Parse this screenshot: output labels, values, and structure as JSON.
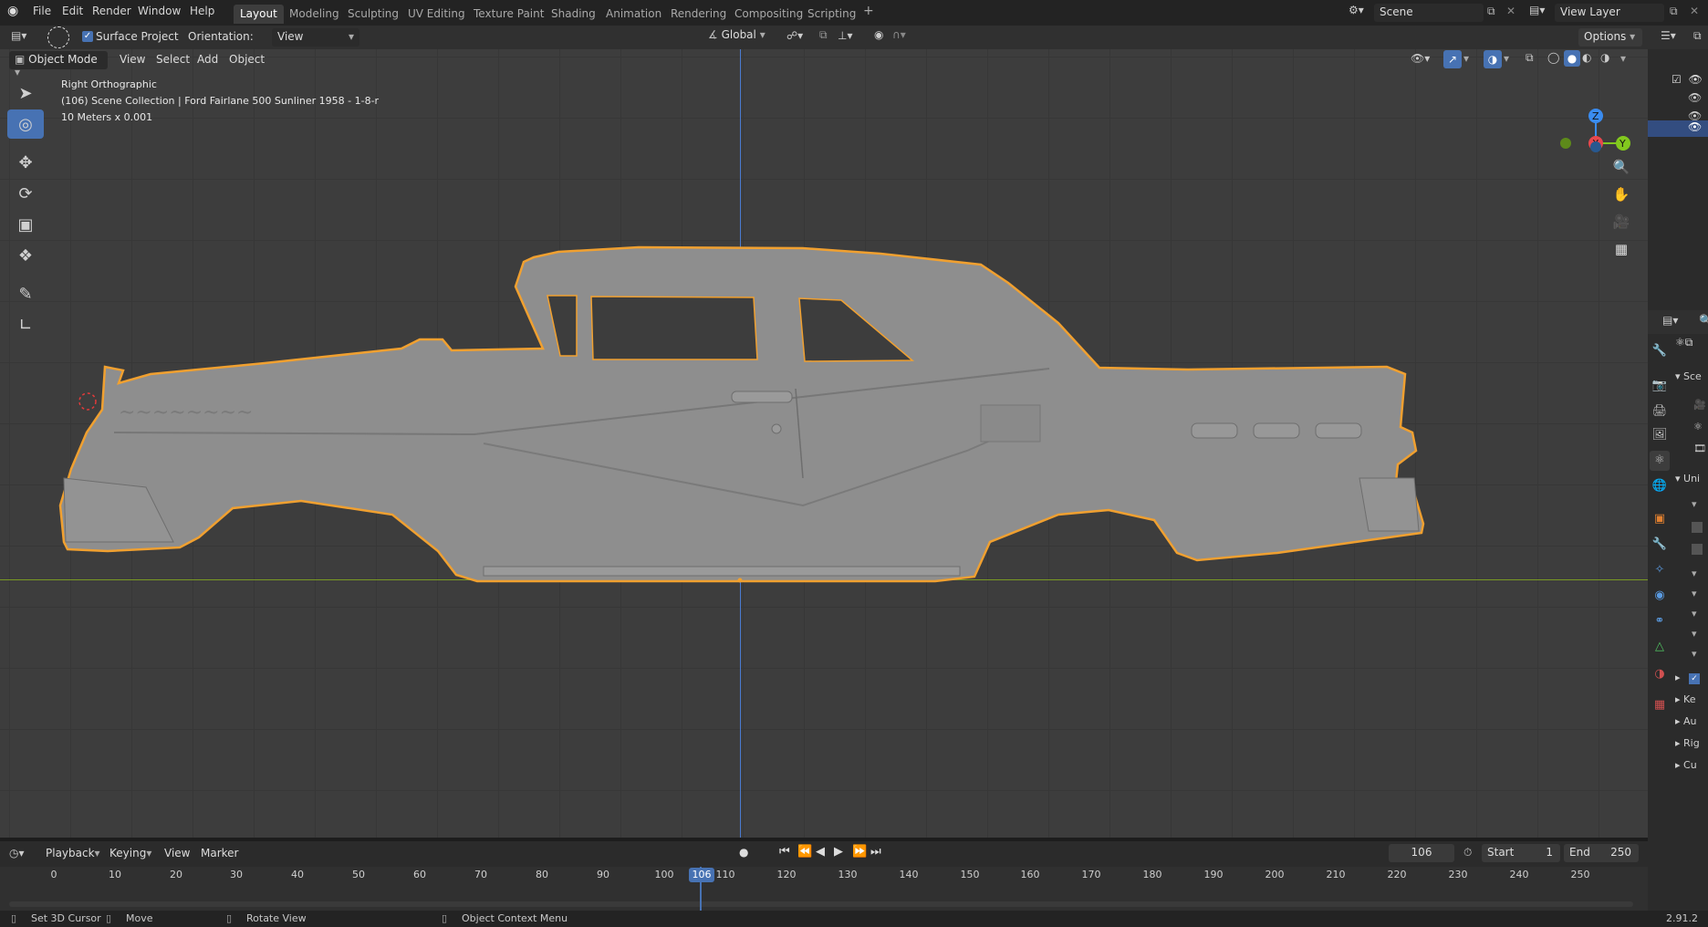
{
  "topbar": {
    "menus": [
      "File",
      "Edit",
      "Render",
      "Window",
      "Help"
    ],
    "workspaces": [
      "Layout",
      "Modeling",
      "Sculpting",
      "UV Editing",
      "Texture Paint",
      "Shading",
      "Animation",
      "Rendering",
      "Compositing",
      "Scripting"
    ],
    "active_workspace": "Layout",
    "add_tab": "+",
    "scene": "Scene",
    "view_layer": "View Layer"
  },
  "tool_header": {
    "surface_project": "Surface Project",
    "orientation_label": "Orientation:",
    "orientation_value": "View",
    "transform_orientation": "Global",
    "options": "Options"
  },
  "viewport_header": {
    "mode": "Object Mode",
    "menus": [
      "View",
      "Select",
      "Add",
      "Object"
    ]
  },
  "viewport": {
    "view_name": "Right Orthographic",
    "collection_info": "(106) Scene Collection | Ford Fairlane 500 Sunliner 1958 - 1-8-r",
    "scale_info": "10 Meters x 0.001",
    "gizmo": {
      "z": "Z",
      "y": "Y",
      "x": "X"
    }
  },
  "timeline": {
    "menus": [
      "Playback",
      "Keying",
      "View",
      "Marker"
    ],
    "current_frame": "106",
    "start_label": "Start",
    "start_value": "1",
    "end_label": "End",
    "end_value": "250",
    "ticks": [
      "0",
      "10",
      "20",
      "30",
      "40",
      "50",
      "60",
      "70",
      "80",
      "90",
      "100",
      "110",
      "120",
      "130",
      "140",
      "150",
      "160",
      "170",
      "180",
      "190",
      "200",
      "210",
      "220",
      "230",
      "240",
      "250"
    ],
    "playhead_label": "106"
  },
  "statusbar": {
    "set_cursor": "Set 3D Cursor",
    "move": "Move",
    "rotate": "Rotate View",
    "context_menu": "Object Context Menu",
    "version": "2.91.2"
  },
  "properties": {
    "truncated_rows": [
      "Sce",
      "Uni",
      "Ke",
      "Au",
      "Rig",
      "Cu"
    ]
  },
  "colors": {
    "selection_outline": "#f0a030",
    "active_tool": "#4772b3",
    "axis_x": "#e8474d",
    "axis_y": "#82c91e",
    "axis_z": "#3a8cf0"
  }
}
